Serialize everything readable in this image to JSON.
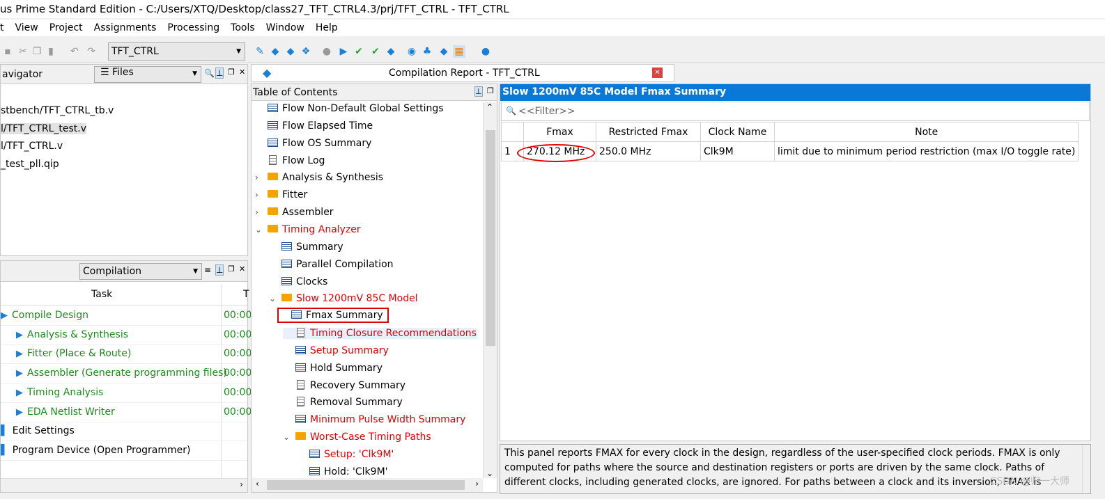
{
  "window": {
    "title": "us Prime Standard Edition - C:/Users/XTQ/Desktop/class27_TFT_CTRL4.3/prj/TFT_CTRL - TFT_CTRL"
  },
  "menu": [
    "t",
    "View",
    "Project",
    "Assignments",
    "Processing",
    "Tools",
    "Window",
    "Help"
  ],
  "toolbar": {
    "project_select": "TFT_CTRL",
    "icons": [
      "save-icon",
      "cut-icon",
      "copy-icon",
      "paste-icon",
      "undo-icon",
      "redo-icon",
      "edit-icon",
      "analysis-icon",
      "fitter-icon",
      "assembler-icon",
      "stop-icon",
      "play-icon",
      "check-icon",
      "check-run-icon",
      "report-icon",
      "timing-icon",
      "netlist-icon",
      "programmer-icon",
      "chip-planner-icon",
      "help-chat-icon"
    ]
  },
  "navigator": {
    "title": "avigator",
    "view_select": "Files",
    "files": [
      "stbench/TFT_CTRL_tb.v",
      "l/TFT_CTRL_test.v",
      "l/TFT_CTRL.v",
      "_test_pll.qip"
    ]
  },
  "tasks": {
    "select": "Compilation",
    "col_task": "Task",
    "col_time": "T",
    "rows": [
      {
        "label": "Compile Design",
        "time": "00:00",
        "level": 0,
        "color": "green"
      },
      {
        "label": "Analysis & Synthesis",
        "time": "00:00",
        "level": 1,
        "color": "green"
      },
      {
        "label": "Fitter (Place & Route)",
        "time": "00:00",
        "level": 1,
        "color": "green"
      },
      {
        "label": "Assembler (Generate programming files)",
        "time": "00:00",
        "level": 1,
        "color": "green"
      },
      {
        "label": "Timing Analysis",
        "time": "00:00",
        "level": 1,
        "color": "green"
      },
      {
        "label": "EDA Netlist Writer",
        "time": "00:00",
        "level": 1,
        "color": "green"
      },
      {
        "label": "Edit Settings",
        "time": "",
        "level": 0,
        "color": "black"
      },
      {
        "label": "Program Device (Open Programmer)",
        "time": "",
        "level": 0,
        "color": "black"
      }
    ]
  },
  "report": {
    "title": "Compilation Report - TFT_CTRL",
    "toc_title": "Table of Contents",
    "toc": [
      {
        "label": "Flow Non-Default Global Settings",
        "icon": "table",
        "level": 0,
        "color": "black"
      },
      {
        "label": "Flow Elapsed Time",
        "icon": "table",
        "level": 0,
        "color": "black"
      },
      {
        "label": "Flow OS Summary",
        "icon": "table",
        "level": 0,
        "color": "black"
      },
      {
        "label": "Flow Log",
        "icon": "doc",
        "level": 0,
        "color": "black"
      },
      {
        "label": "Analysis & Synthesis",
        "icon": "folder",
        "level": 0,
        "color": "black",
        "chev": "›"
      },
      {
        "label": "Fitter",
        "icon": "folder",
        "level": 0,
        "color": "black",
        "chev": "›"
      },
      {
        "label": "Assembler",
        "icon": "folder",
        "level": 0,
        "color": "black",
        "chev": "›"
      },
      {
        "label": "Timing Analyzer",
        "icon": "folder",
        "level": 0,
        "color": "red",
        "chev": "⌄"
      },
      {
        "label": "Summary",
        "icon": "table",
        "level": 1,
        "color": "black"
      },
      {
        "label": "Parallel Compilation",
        "icon": "table",
        "level": 1,
        "color": "black"
      },
      {
        "label": "Clocks",
        "icon": "table",
        "level": 1,
        "color": "black"
      },
      {
        "label": "Slow 1200mV 85C Model",
        "icon": "folder",
        "level": 1,
        "color": "red",
        "chev": "⌄"
      },
      {
        "label": "Fmax Summary",
        "icon": "table",
        "level": 2,
        "color": "black",
        "selected": true
      },
      {
        "label": "Timing Closure Recommendations",
        "icon": "doc",
        "level": 2,
        "color": "red"
      },
      {
        "label": "Setup Summary",
        "icon": "table",
        "level": 2,
        "color": "red"
      },
      {
        "label": "Hold Summary",
        "icon": "table",
        "level": 2,
        "color": "black"
      },
      {
        "label": "Recovery Summary",
        "icon": "doc",
        "level": 2,
        "color": "black"
      },
      {
        "label": "Removal Summary",
        "icon": "doc",
        "level": 2,
        "color": "black"
      },
      {
        "label": "Minimum Pulse Width Summary",
        "icon": "table",
        "level": 2,
        "color": "red"
      },
      {
        "label": "Worst-Case Timing Paths",
        "icon": "folder",
        "level": 2,
        "color": "red",
        "chev": "⌄"
      },
      {
        "label": "Setup: 'Clk9M'",
        "icon": "table",
        "level": 3,
        "color": "red"
      },
      {
        "label": "Hold: 'Clk9M'",
        "icon": "table",
        "level": 3,
        "color": "black"
      }
    ]
  },
  "detail": {
    "header": "Slow 1200mV 85C Model Fmax Summary",
    "filter_placeholder": "<<Filter>>",
    "columns": [
      "",
      "Fmax",
      "Restricted Fmax",
      "Clock Name",
      "Note"
    ],
    "rows": [
      [
        "1",
        "270.12 MHz",
        "250.0 MHz",
        "Clk9M",
        "limit due to minimum period restriction (max I/O toggle rate)"
      ]
    ],
    "description": "This panel reports FMAX for every clock in the design, regardless of the user-specified clock periods.  FMAX is only computed for paths where the source and destination registers or ports are driven by the same clock.  Paths of different clocks, including generated clocks, are ignored.  For paths between a clock and its inversion, FMAX is computed as if the"
  },
  "watermark": "CSDN @归一大师",
  "colors": {
    "header_blue": "#0a78d7",
    "highlight_red": "#e00000",
    "task_green": "#1c8a1c"
  }
}
